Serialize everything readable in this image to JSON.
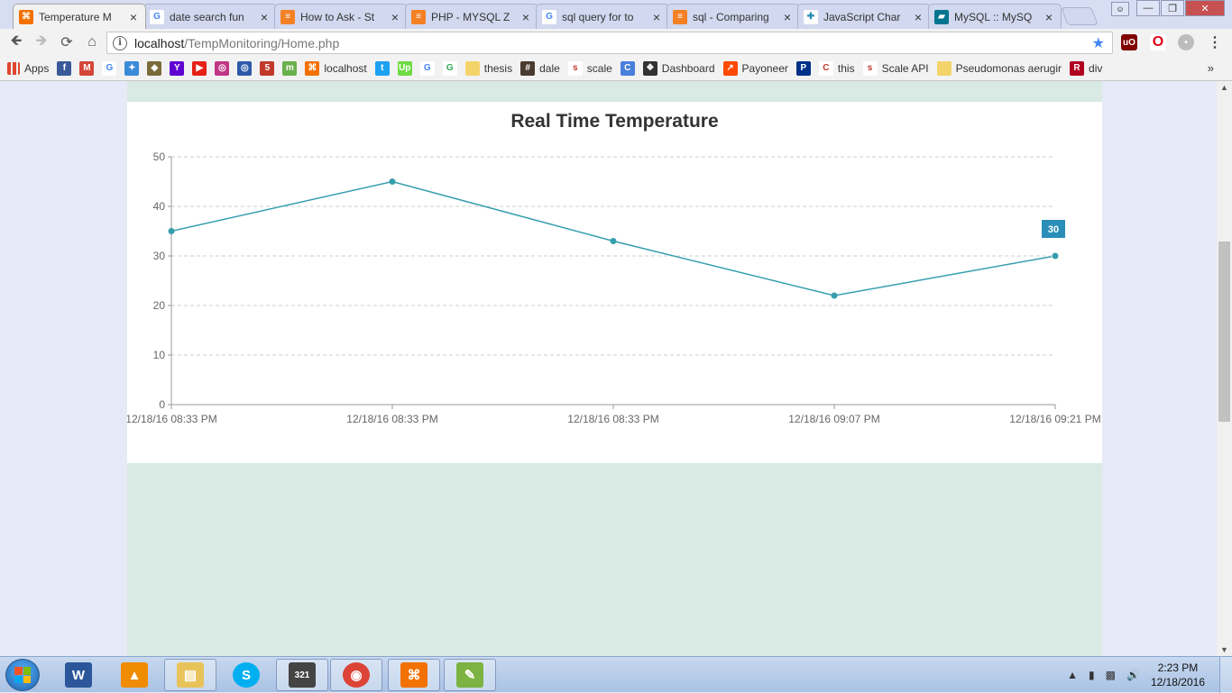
{
  "browser": {
    "tabs": [
      {
        "title": "Temperature M",
        "icon": "xampp-icon",
        "active": true
      },
      {
        "title": "date search fun",
        "icon": "google-icon",
        "active": false
      },
      {
        "title": "How to Ask - St",
        "icon": "stackoverflow-icon",
        "active": false
      },
      {
        "title": "PHP - MYSQL Z",
        "icon": "stackoverflow-icon",
        "active": false
      },
      {
        "title": "sql query for to",
        "icon": "google-icon",
        "active": false
      },
      {
        "title": "sql - Comparing",
        "icon": "stackoverflow-icon",
        "active": false
      },
      {
        "title": "JavaScript Char",
        "icon": "canvasjs-icon",
        "active": false
      },
      {
        "title": "MySQL :: MySQ",
        "icon": "mysql-icon",
        "active": false
      }
    ],
    "close_glyph": "×",
    "url_host": "localhost",
    "url_path": "/TempMonitoring/Home.php",
    "bookmarks": [
      {
        "label": "Apps",
        "icon": "apps-icon",
        "color": "#e0452f"
      },
      {
        "label": "",
        "icon": "facebook-icon",
        "color": "#3b5998",
        "glyph": "f"
      },
      {
        "label": "",
        "icon": "gmail-icon",
        "color": "#d44638",
        "glyph": "M"
      },
      {
        "label": "",
        "icon": "google-icon",
        "color": "#4285f4",
        "glyph": "G"
      },
      {
        "label": "",
        "icon": "bookmark-icon",
        "color": "#3b8bd8",
        "glyph": "✦"
      },
      {
        "label": "",
        "icon": "shield-icon",
        "color": "#7b6b3a",
        "glyph": "◆"
      },
      {
        "label": "",
        "icon": "yahoo-icon",
        "color": "#5f01d1",
        "glyph": "Y"
      },
      {
        "label": "",
        "icon": "youtube-icon",
        "color": "#e62117",
        "glyph": "▶"
      },
      {
        "label": "",
        "icon": "instagram-icon",
        "color": "#c13584",
        "glyph": "◎"
      },
      {
        "label": "",
        "icon": "target-icon",
        "color": "#2e5aa8",
        "glyph": "◎"
      },
      {
        "label": "",
        "icon": "five-icon",
        "color": "#c0392b",
        "glyph": "5"
      },
      {
        "label": "",
        "icon": "ms-icon",
        "color": "#6ab04c",
        "glyph": "m"
      },
      {
        "label": "localhost",
        "icon": "xampp-icon",
        "color": "#f37100",
        "glyph": "⌘"
      },
      {
        "label": "",
        "icon": "twitter-icon",
        "color": "#1da1f2",
        "glyph": "t"
      },
      {
        "label": "",
        "icon": "upwork-icon",
        "color": "#6fda44",
        "glyph": "Up"
      },
      {
        "label": "",
        "icon": "google-icon",
        "color": "#4285f4",
        "glyph": "G"
      },
      {
        "label": "",
        "icon": "google-icon",
        "color": "#34a853",
        "glyph": "G"
      },
      {
        "label": "thesis",
        "icon": "folder-icon",
        "color": "#f4d46a",
        "glyph": ""
      },
      {
        "label": "dale",
        "icon": "hash-icon",
        "color": "#4a3b30",
        "glyph": "#"
      },
      {
        "label": "scale",
        "icon": "scale-icon",
        "color": "#ffffff",
        "glyph": "s"
      },
      {
        "label": "",
        "icon": "refresh-c-icon",
        "color": "#4a7fdc",
        "glyph": "C"
      },
      {
        "label": "Dashboard",
        "icon": "dropbox-icon",
        "color": "#333333",
        "glyph": "❖"
      },
      {
        "label": "Payoneer",
        "icon": "payoneer-icon",
        "color": "#ff4800",
        "glyph": "↗"
      },
      {
        "label": "",
        "icon": "paypal-icon",
        "color": "#003087",
        "glyph": "P"
      },
      {
        "label": "this",
        "icon": "c-icon",
        "color": "#ffffff",
        "glyph": "C"
      },
      {
        "label": "Scale API",
        "icon": "scale-icon",
        "color": "#ffffff",
        "glyph": "s"
      },
      {
        "label": "Pseudomonas aerugir",
        "icon": "note-icon",
        "color": "#f4d46a",
        "glyph": ""
      },
      {
        "label": "div",
        "icon": "r-icon",
        "color": "#b00020",
        "glyph": "R"
      }
    ],
    "bookmarks_more": "»"
  },
  "chart_data": {
    "type": "line",
    "title": "Real Time Temperature",
    "categories": [
      "12/18/16 08:33 PM",
      "12/18/16 08:33 PM",
      "12/18/16 08:33 PM",
      "12/18/16 09:07 PM",
      "12/18/16 09:21 PM"
    ],
    "values": [
      35,
      45,
      33,
      22,
      30
    ],
    "ylim": [
      0,
      50
    ],
    "yticks": [
      0,
      10,
      20,
      30,
      40,
      50
    ],
    "grid": true,
    "xlabel": "",
    "ylabel": "",
    "highlight_label": "30",
    "colors": {
      "line": "#369ead",
      "label_bg": "#2a8fb8"
    }
  },
  "taskbar": {
    "apps": [
      {
        "name": "word",
        "icon": "word-icon",
        "glyph": "W",
        "color": "#2b579a"
      },
      {
        "name": "vlc",
        "icon": "vlc-icon",
        "glyph": "▲",
        "color": "#f08c00"
      },
      {
        "name": "explorer",
        "icon": "folder-icon",
        "glyph": "▤",
        "color": "#e8c35a"
      },
      {
        "name": "skype",
        "icon": "skype-icon",
        "glyph": "S",
        "color": "#00aff0"
      },
      {
        "name": "media-player",
        "icon": "mpc-icon",
        "glyph": "321",
        "color": "#444444"
      },
      {
        "name": "chrome",
        "icon": "chrome-icon",
        "glyph": "◉",
        "color": "#db4437"
      },
      {
        "name": "xampp",
        "icon": "xampp-icon",
        "glyph": "⌘",
        "color": "#f37100"
      },
      {
        "name": "notepad-plus",
        "icon": "notepad-icon",
        "glyph": "✎",
        "color": "#7cb342"
      }
    ],
    "time": "2:23 PM",
    "date": "12/18/2016"
  }
}
